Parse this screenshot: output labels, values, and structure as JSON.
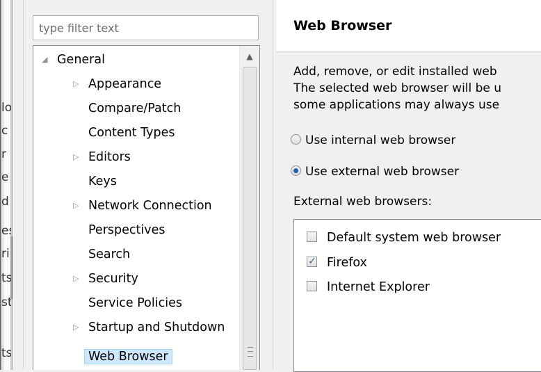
{
  "behind_fragments": [
    "lo",
    "c",
    "r",
    "e",
    "d",
    "es",
    "ri",
    "ts",
    "st",
    "ts"
  ],
  "filter": {
    "placeholder": "type filter text"
  },
  "tree": {
    "items": [
      {
        "label": "General",
        "expander": "expanded",
        "level": 0
      },
      {
        "label": "Appearance",
        "expander": "collapsed",
        "level": 1
      },
      {
        "label": "Compare/Patch",
        "expander": "none",
        "level": 1
      },
      {
        "label": "Content Types",
        "expander": "none",
        "level": 1
      },
      {
        "label": "Editors",
        "expander": "collapsed",
        "level": 1
      },
      {
        "label": "Keys",
        "expander": "none",
        "level": 1
      },
      {
        "label": "Network Connection",
        "expander": "collapsed",
        "level": 1
      },
      {
        "label": "Perspectives",
        "expander": "none",
        "level": 1
      },
      {
        "label": "Search",
        "expander": "none",
        "level": 1
      },
      {
        "label": "Security",
        "expander": "collapsed",
        "level": 1
      },
      {
        "label": "Service Policies",
        "expander": "none",
        "level": 1
      },
      {
        "label": "Startup and Shutdown",
        "expander": "collapsed",
        "level": 1
      },
      {
        "label": "Web Browser",
        "expander": "none",
        "level": 1,
        "selected": true
      }
    ]
  },
  "page": {
    "title": "Web Browser",
    "description": [
      "Add, remove, or edit installed web",
      "The selected web browser will be u",
      "some applications may always use"
    ],
    "radio_internal": {
      "label": "Use internal web browser",
      "checked": false
    },
    "radio_external": {
      "label": "Use external web browser",
      "checked": true
    },
    "external_label": "External web browsers:",
    "browsers": [
      {
        "label": "Default system web browser",
        "checked": false
      },
      {
        "label": "Firefox",
        "checked": true
      },
      {
        "label": "Internet Explorer",
        "checked": false
      }
    ]
  },
  "colors": {
    "selection_bg": "#cde8ff",
    "selection_border": "#99d1ff",
    "radio_dot": "#1f5fb3"
  }
}
